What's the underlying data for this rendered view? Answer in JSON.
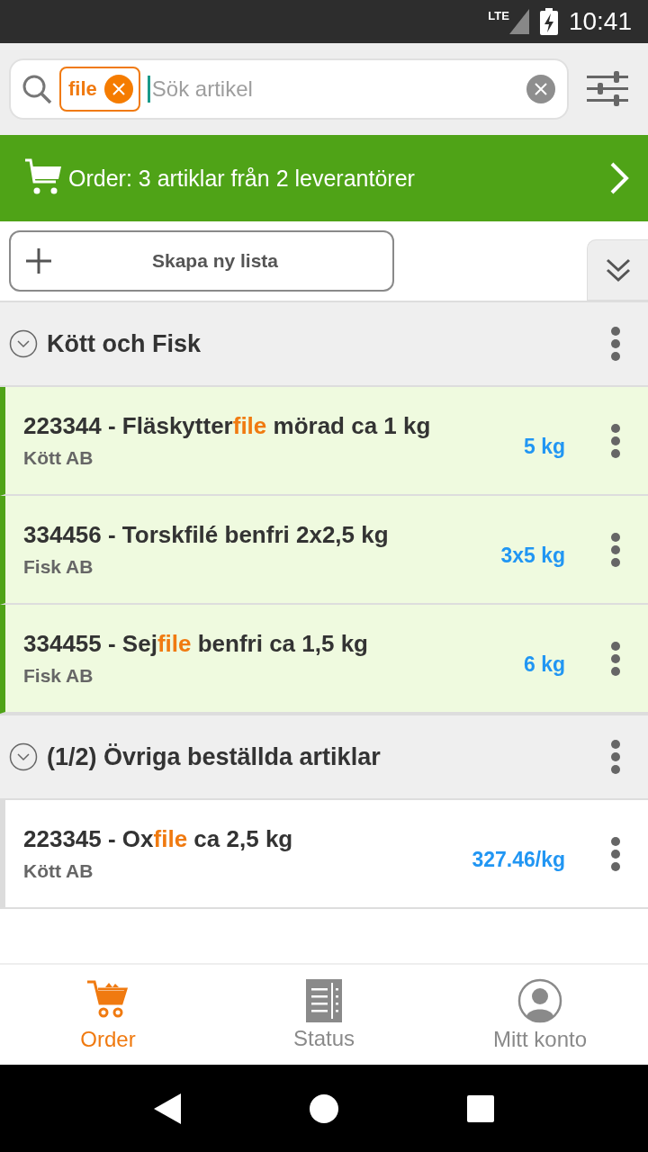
{
  "status_bar": {
    "network": "LTE",
    "time": "10:41"
  },
  "search": {
    "chip": "file",
    "placeholder": "Sök artikel"
  },
  "order_banner": {
    "text": "Order: 3 artiklar från 2 leverantörer"
  },
  "create_button": {
    "label": "Skapa ny lista"
  },
  "groups": [
    {
      "title": "Kött och Fisk",
      "expanded": true,
      "items": [
        {
          "title": [
            {
              "text": "223344 - Fläskytter",
              "highlight": false
            },
            {
              "text": "file",
              "highlight": true
            },
            {
              "text": " mörad ca 1 kg",
              "highlight": false
            }
          ],
          "supplier": "Kött AB",
          "quantity": "5 kg",
          "in_order": true
        },
        {
          "title": [
            {
              "text": "334456 - Torskfilé benfri 2x2,5 kg",
              "highlight": false
            }
          ],
          "supplier": "Fisk AB",
          "quantity": "3x5 kg",
          "in_order": true
        },
        {
          "title": [
            {
              "text": "334455 - Sej",
              "highlight": false
            },
            {
              "text": "file",
              "highlight": true
            },
            {
              "text": " benfri ca 1,5 kg",
              "highlight": false
            }
          ],
          "supplier": "Fisk AB",
          "quantity": "6 kg",
          "in_order": true
        }
      ]
    },
    {
      "title": "(1/2) Övriga beställda artiklar",
      "expanded": true,
      "items": [
        {
          "title": [
            {
              "text": "223345 - Ox",
              "highlight": false
            },
            {
              "text": "file",
              "highlight": true
            },
            {
              "text": " ca 2,5 kg",
              "highlight": false
            }
          ],
          "supplier": "Kött AB",
          "quantity": "327.46/kg",
          "in_order": false
        }
      ]
    }
  ],
  "bottom_nav": [
    {
      "label": "Order",
      "kind": "cart",
      "selected": true
    },
    {
      "label": "Status",
      "kind": "status",
      "selected": false
    },
    {
      "label": "Mitt konto",
      "kind": "account",
      "selected": false
    }
  ]
}
